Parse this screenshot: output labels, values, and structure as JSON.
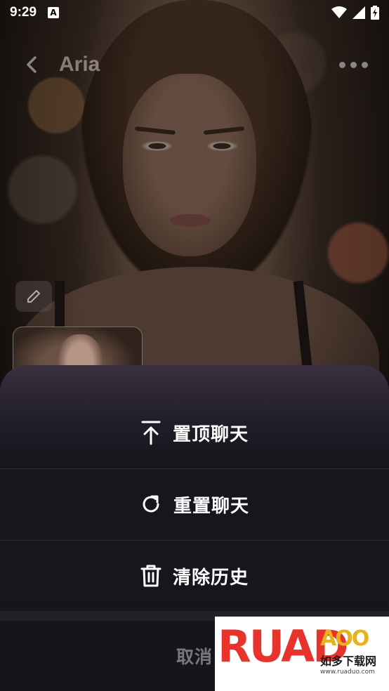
{
  "status_bar": {
    "time": "9:29",
    "notification_icon": "a-letter-icon",
    "icons": [
      "wifi-icon",
      "signal-icon",
      "battery-charging-icon"
    ]
  },
  "header": {
    "title": "Aria",
    "back_icon": "chevron-left-icon",
    "more_icon": "more-horizontal-icon"
  },
  "action_sheet": {
    "options": [
      {
        "label": "置顶聊天",
        "icon": "pin-top-icon"
      },
      {
        "label": "重置聊天",
        "icon": "refresh-icon"
      },
      {
        "label": "清除历史",
        "icon": "trash-icon"
      }
    ],
    "cancel_label": "取消"
  },
  "watermark": {
    "logo_text": "RUAD",
    "logo_small": "AOO",
    "subtitle": "如多下载网",
    "url": "www.ruaduo.com"
  },
  "colors": {
    "sheet_background": "#15151c",
    "sheet_top_tint": "#3b3040",
    "option_text": "#ffffff",
    "cancel_text": "#8e8e93"
  }
}
